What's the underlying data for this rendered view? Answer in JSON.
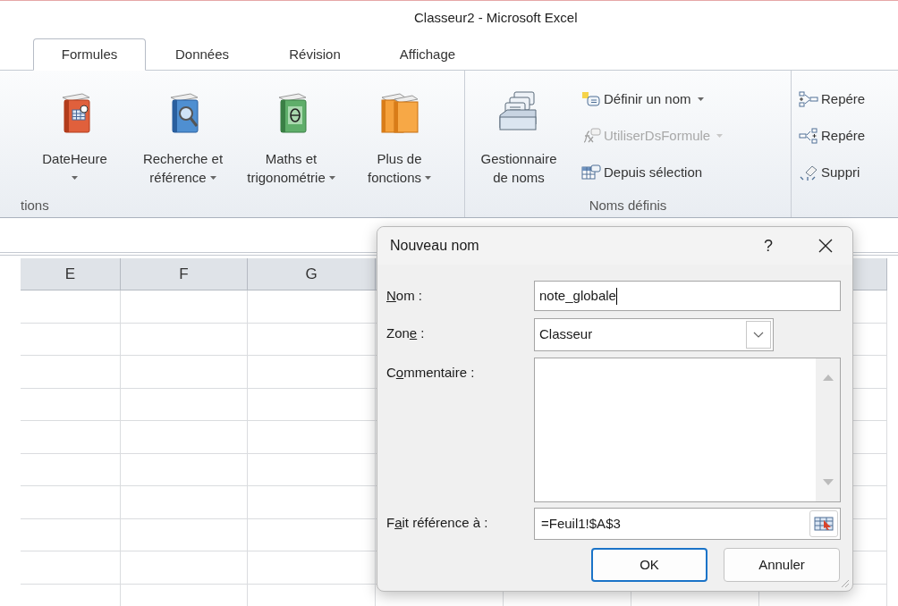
{
  "window": {
    "title": "Classeur2 - Microsoft Excel"
  },
  "tabs": [
    {
      "label": "Formules",
      "selected": true
    },
    {
      "label": "Données",
      "selected": false
    },
    {
      "label": "Révision",
      "selected": false
    },
    {
      "label": "Affichage",
      "selected": false
    }
  ],
  "ribbon": {
    "groups": [
      {
        "label": "tions",
        "large_buttons": [
          {
            "lines": [
              "DateHeure"
            ],
            "dropdown": true
          },
          {
            "lines": [
              "Recherche et",
              "référence"
            ],
            "dropdown": true
          },
          {
            "lines": [
              "Maths et",
              "trigonométrie"
            ],
            "dropdown": true
          },
          {
            "lines": [
              "Plus de",
              "fonctions"
            ],
            "dropdown": true
          }
        ]
      },
      {
        "label": "Noms définis",
        "large_buttons": [
          {
            "lines": [
              "Gestionnaire",
              "de noms"
            ],
            "dropdown": false
          }
        ],
        "commands": [
          {
            "label": "Définir un nom",
            "dropdown": true,
            "disabled": false
          },
          {
            "label": "UtiliserDsFormule",
            "dropdown": true,
            "disabled": true
          },
          {
            "label": "Depuis sélection",
            "dropdown": false,
            "disabled": false
          }
        ]
      },
      {
        "commands": [
          {
            "label": "Repére",
            "dropdown": false,
            "disabled": false
          },
          {
            "label": "Repére",
            "dropdown": false,
            "disabled": false
          },
          {
            "label": "Suppri",
            "dropdown": false,
            "disabled": false
          }
        ]
      }
    ]
  },
  "sheet": {
    "columns": [
      "E",
      "F",
      "G"
    ]
  },
  "dialog": {
    "title": "Nouveau nom",
    "help": "?",
    "fields": [
      {
        "kind": "text",
        "label": [
          {
            "text": "N",
            "underlined": true
          },
          {
            "text": "om :",
            "underlined": false
          }
        ],
        "value": "note_globale",
        "focused": true
      },
      {
        "kind": "combo",
        "label": [
          {
            "text": "Zon",
            "underlined": false
          },
          {
            "text": "e",
            "underlined": true
          },
          {
            "text": " :",
            "underlined": false
          }
        ],
        "value": "Classeur"
      },
      {
        "kind": "memo",
        "label": [
          {
            "text": "C",
            "underlined": false
          },
          {
            "text": "o",
            "underlined": true
          },
          {
            "text": "mmentaire :",
            "underlined": false
          }
        ]
      },
      {
        "kind": "reference",
        "label": [
          {
            "text": "F",
            "underlined": false
          },
          {
            "text": "a",
            "underlined": true
          },
          {
            "text": "it référence à :",
            "underlined": false
          }
        ],
        "value": "=Feuil1!$A$3"
      }
    ],
    "buttons": [
      {
        "label": "OK",
        "default": true
      },
      {
        "label": "Annuler",
        "default": false
      }
    ]
  }
}
